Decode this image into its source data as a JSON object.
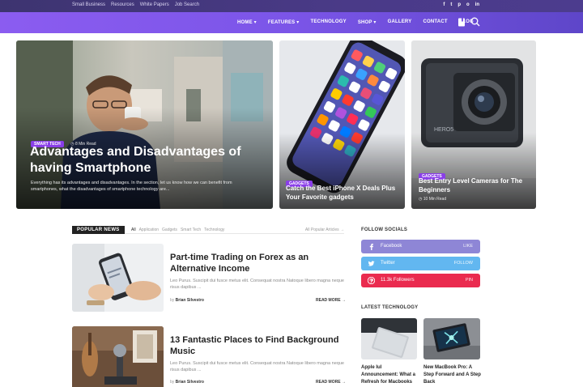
{
  "topbar": {
    "links": [
      "Small Business",
      "Resources",
      "White Papers",
      "Job Search"
    ],
    "social": [
      "f",
      "t",
      "p",
      "o",
      "in"
    ]
  },
  "nav": {
    "items": [
      "HOME ▾",
      "FEATURES ▾",
      "TECHNOLOGY",
      "SHOP ▾",
      "GALLERY",
      "CONTACT",
      "BLOG"
    ]
  },
  "hero": {
    "main": {
      "badge": "SMART TECH",
      "time": "◷ 8 Min Read",
      "title": "Advantages and Disadvantages of having Smartphone",
      "excerpt": "Everything has its advantages and disadvantages. In the section, let us know how we can benefit from smartphones, what the disadvantages of smartphone technology are..."
    },
    "phone": {
      "badge": "GADGETS",
      "title": "Catch the Best iPhone X Deals Plus Your Favorite gadgets"
    },
    "camera": {
      "badge": "GADGETS",
      "title": "Best Entry Level Cameras for The Beginners",
      "time": "◷ 10 Min Read"
    }
  },
  "popular": {
    "label": "POPULAR NEWS",
    "tabs": [
      "All",
      "Application",
      "Gadgets",
      "Smart Tech",
      "Technology"
    ],
    "all_link": "All Popular Articles →",
    "posts": [
      {
        "title": "Part-time Trading on Forex as an Alternative Income",
        "excerpt": "Leo Purus. Suscipit dui fusce metus elit. Consequat nostra Natoque libero magna neque risus dapibus ...",
        "by_prefix": "by",
        "author": "Brian Silvestro",
        "readmore": "READ MORE →"
      },
      {
        "title": "13 Fantastic Places to Find Background Music",
        "excerpt": "Leo Purus. Suscipit dui fusce metus elit. Consequat nostra Natoque libero magna neque risus dapibus ...",
        "by_prefix": "by",
        "author": "Brian Silvestro",
        "readmore": "READ MORE →"
      }
    ]
  },
  "sidebar": {
    "follow_heading": "FOLLOW SOCIALS",
    "socials": [
      {
        "name": "Facebook",
        "action": "LIKE",
        "color": "#8e86d6"
      },
      {
        "name": "Twitter",
        "action": "FOLLOW",
        "color": "#62b7f0"
      },
      {
        "name": "11.3k Followers",
        "action": "PIN",
        "color": "#ea2b4f"
      }
    ],
    "latest_heading": "LATEST TECHNOLOGY",
    "latest": [
      {
        "title": "Apple Iul Announcement: What a Refresh for Macbooks"
      },
      {
        "title": "New MacBook Pro: A Step Forward and A Step Back"
      }
    ]
  },
  "colors": {
    "accent": "#8a3ee8",
    "nav_start": "#8b5cf0",
    "nav_end": "#5e46c9"
  }
}
